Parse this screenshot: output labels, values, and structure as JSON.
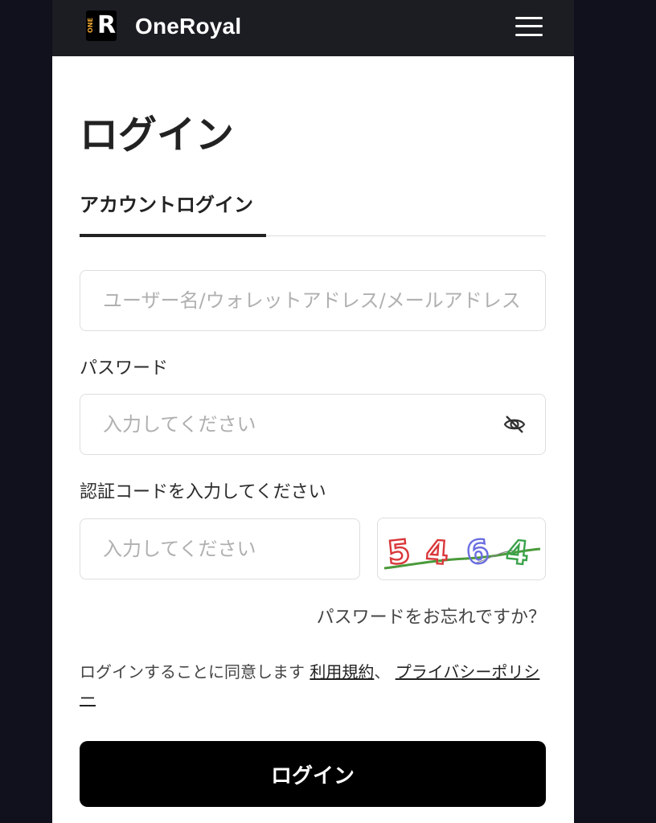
{
  "header": {
    "logo_small_text": "ONE",
    "logo_letter": "R",
    "brand_name": "OneRoyal",
    "menu_icon": "hamburger-menu-icon"
  },
  "page": {
    "title": "ログイン",
    "tab_label": "アカウントログイン"
  },
  "form": {
    "username_placeholder": "ユーザー名/ウォレットアドレス/メールアドレス",
    "password_label": "パスワード",
    "password_placeholder": "入力してください",
    "password_toggle_icon": "eye-off-icon",
    "captcha_label": "認証コードを入力してください",
    "captcha_placeholder": "入力してください",
    "captcha_digits": [
      "5",
      "4",
      "6",
      "4"
    ],
    "captcha_colors": [
      "#d9373a",
      "#d9373a",
      "#6a6ee0",
      "#3aa24a"
    ],
    "forgot_password": "パスワードをお忘れですか？",
    "agreement_text": "ログインすることに同意します",
    "terms_link": "利用規約",
    "separator": "、",
    "privacy_link": "プライバシーポリシー",
    "submit_label": "ログイン"
  },
  "colors": {
    "header_bg": "#1b1d22",
    "page_bg": "#10111c",
    "accent": "#f0a830",
    "button_bg": "#000000"
  }
}
